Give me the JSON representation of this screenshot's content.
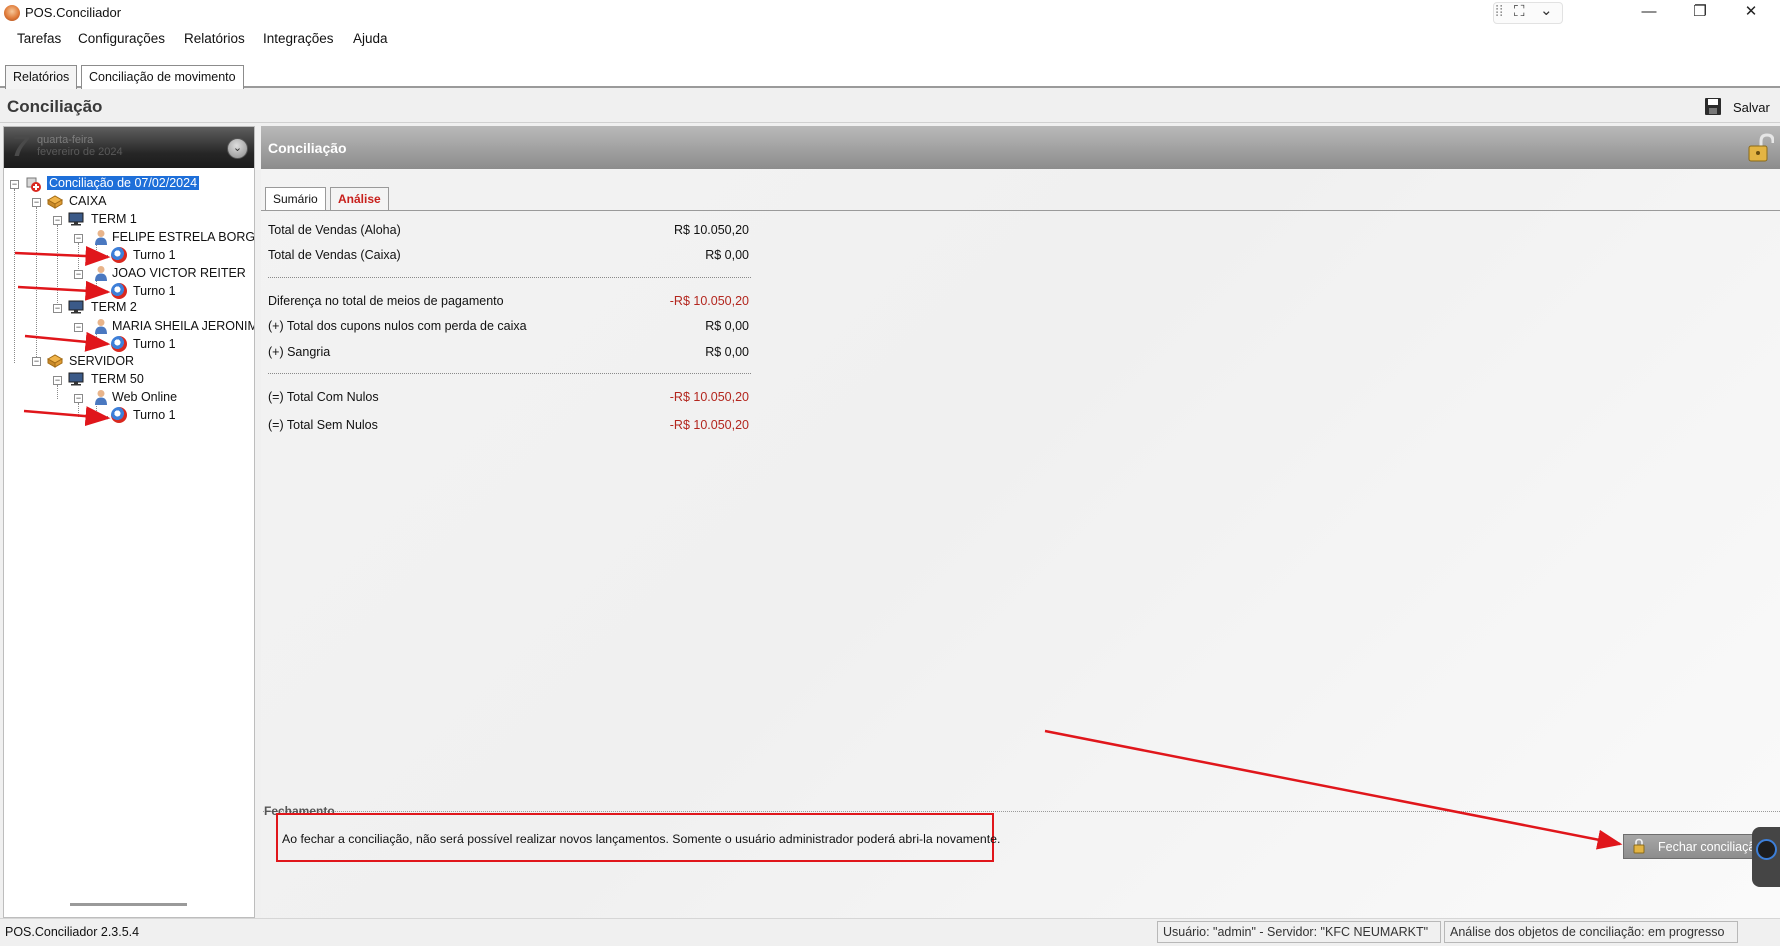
{
  "window": {
    "title": "POS.Conciliador",
    "controls": {
      "minimize": "—",
      "restore": "❐",
      "close": "✕"
    },
    "snap_glyphs": {
      "grip": "⁞⁞",
      "expand": "⛶",
      "chevron": "⌄"
    }
  },
  "menu": {
    "items": [
      "Tarefas",
      "Configurações",
      "Relatórios",
      "Integrações",
      "Ajuda"
    ]
  },
  "tabs": [
    {
      "label": "Relatórios",
      "active": false
    },
    {
      "label": "Conciliação de movimento",
      "active": true
    }
  ],
  "header": {
    "title": "Conciliação",
    "save_label": "Salvar"
  },
  "calendar": {
    "day": "7",
    "weekday": "quarta-feira",
    "full_date": "fevereiro de 2024",
    "dropdown_glyph": "⌄"
  },
  "tree": {
    "root": "Conciliação de 07/02/2024",
    "caixa": "CAIXA",
    "term1": "TERM 1",
    "felipe": "FELIPE ESTRELA BORGES I",
    "felipe_shift": "Turno 1",
    "joao": "JOAO VICTOR REITER",
    "joao_shift": "Turno 1",
    "term2": "TERM 2",
    "maria": "MARIA SHEILA JERONIMO",
    "maria_shift": "Turno 1",
    "servidor": "SERVIDOR",
    "term50": "TERM 50",
    "web": "Web Online",
    "web_shift": "Turno 1",
    "toggle_glyph": "−"
  },
  "main": {
    "title": "Conciliação",
    "subtabs": {
      "sumario": "Sumário",
      "analise": "Análise"
    },
    "summary": {
      "vendas_aloha": {
        "label": "Total de Vendas (Aloha)",
        "value": "R$ 10.050,20"
      },
      "vendas_caixa": {
        "label": "Total de Vendas (Caixa)",
        "value": "R$ 0,00"
      },
      "diferenca": {
        "label": "Diferença no total de meios de pagamento",
        "value": "-R$ 10.050,20"
      },
      "cupons_nulos": {
        "label": "(+) Total dos cupons nulos com perda de caixa",
        "value": "R$ 0,00"
      },
      "sangria": {
        "label": "(+) Sangria",
        "value": "R$ 0,00"
      },
      "total_com_nulos": {
        "label": "(=) Total Com Nulos",
        "value": "-R$ 10.050,20"
      },
      "total_sem_nulos": {
        "label": "(=) Total Sem Nulos",
        "value": "-R$ 10.050,20"
      }
    },
    "fechamento": {
      "title": "Fechamento",
      "warning": "Ao fechar a conciliação, não será possível realizar novos lançamentos. Somente o usuário administrador poderá abri-la novamente.",
      "button_label": "Fechar conciliação"
    }
  },
  "status": {
    "version": "POS.Conciliador 2.3.5.4",
    "user_server": "Usuário: \"admin\" - Servidor: \"KFC NEUMARKT\"",
    "progress": "Análise dos objetos de conciliação: em progresso"
  },
  "colors": {
    "negative": "#b3261e",
    "annotation_red": "#e0161b",
    "selection": "#1e6fd9"
  }
}
